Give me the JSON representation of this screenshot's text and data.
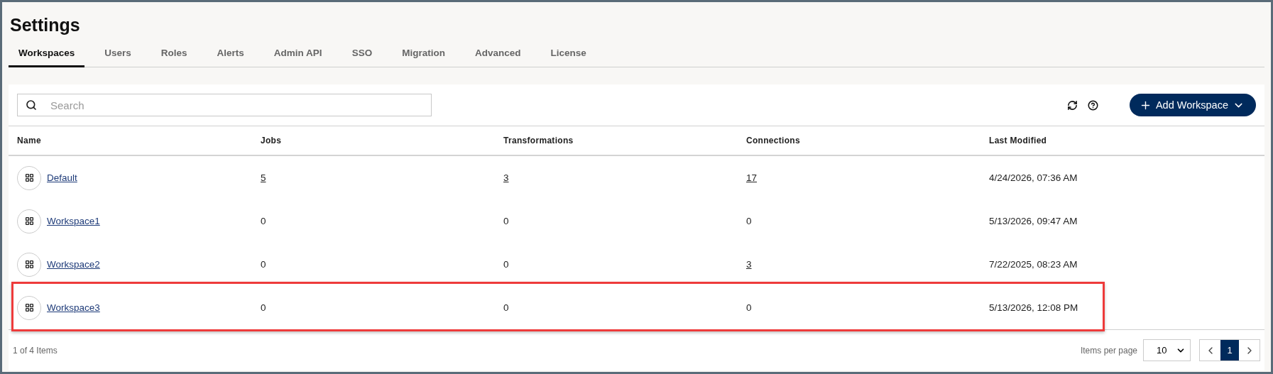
{
  "page": {
    "title": "Settings"
  },
  "tabs": [
    {
      "label": "Workspaces",
      "selected": true
    },
    {
      "label": "Users",
      "selected": false
    },
    {
      "label": "Roles",
      "selected": false
    },
    {
      "label": "Alerts",
      "selected": false
    },
    {
      "label": "Admin API",
      "selected": false
    },
    {
      "label": "SSO",
      "selected": false
    },
    {
      "label": "Migration",
      "selected": false
    },
    {
      "label": "Advanced",
      "selected": false
    },
    {
      "label": "License",
      "selected": false
    }
  ],
  "search": {
    "placeholder": "Search"
  },
  "add_button": {
    "label": "Add Workspace"
  },
  "table": {
    "columns": [
      "Name",
      "Jobs",
      "Transformations",
      "Connections",
      "Last Modified"
    ],
    "rows": [
      {
        "highlighted": false,
        "name": "Default",
        "jobs": {
          "text": "5",
          "link": true
        },
        "transformations": {
          "text": "3",
          "link": true
        },
        "connections": {
          "text": "17",
          "link": true
        },
        "last_modified": "4/24/2026, 07:36 AM"
      },
      {
        "highlighted": false,
        "name": "Workspace1",
        "jobs": {
          "text": "0",
          "link": false
        },
        "transformations": {
          "text": "0",
          "link": false
        },
        "connections": {
          "text": "0",
          "link": false
        },
        "last_modified": "5/13/2026, 09:47 AM"
      },
      {
        "highlighted": false,
        "name": "Workspace2",
        "jobs": {
          "text": "0",
          "link": false
        },
        "transformations": {
          "text": "0",
          "link": false
        },
        "connections": {
          "text": "3",
          "link": true
        },
        "last_modified": "7/22/2025, 08:23 AM"
      },
      {
        "highlighted": true,
        "name": "Workspace3",
        "jobs": {
          "text": "0",
          "link": false
        },
        "transformations": {
          "text": "0",
          "link": false
        },
        "connections": {
          "text": "0",
          "link": false
        },
        "last_modified": "5/13/2026, 12:08 PM"
      }
    ]
  },
  "footer": {
    "count": "1 of 4 Items",
    "per_page_label": "Items per page",
    "per_page": "10",
    "pages": [
      {
        "label": "1",
        "selected": true
      }
    ]
  }
}
